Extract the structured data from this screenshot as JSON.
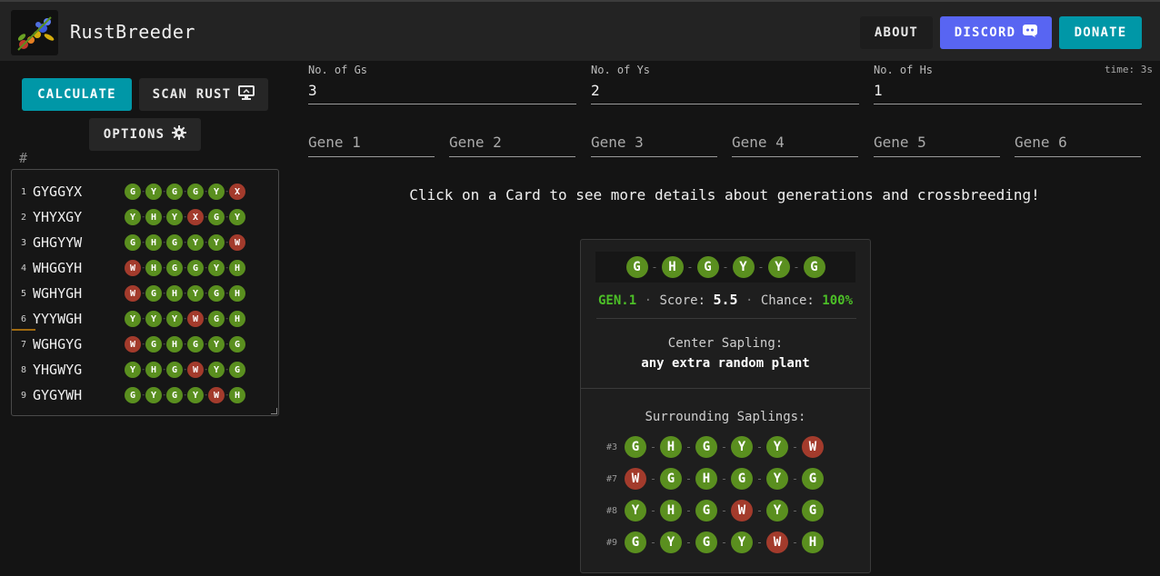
{
  "header": {
    "title": "RustBreeder",
    "about_label": "ABOUT",
    "discord_label": "DISCORD",
    "donate_label": "DONATE"
  },
  "toolbar": {
    "calculate_label": "CALCULATE",
    "scan_label": "SCAN RUST",
    "options_label": "OPTIONS"
  },
  "list": {
    "header": "#",
    "rows": [
      {
        "num": "1",
        "name": "GYGGYX",
        "genes": [
          "G",
          "Y",
          "G",
          "G",
          "Y",
          "X"
        ]
      },
      {
        "num": "2",
        "name": "YHYXGY",
        "genes": [
          "Y",
          "H",
          "Y",
          "X",
          "G",
          "Y"
        ]
      },
      {
        "num": "3",
        "name": "GHGYYW",
        "genes": [
          "G",
          "H",
          "G",
          "Y",
          "Y",
          "W"
        ]
      },
      {
        "num": "4",
        "name": "WHGGYH",
        "genes": [
          "W",
          "H",
          "G",
          "G",
          "Y",
          "H"
        ]
      },
      {
        "num": "5",
        "name": "WGHYGH",
        "genes": [
          "W",
          "G",
          "H",
          "Y",
          "G",
          "H"
        ]
      },
      {
        "num": "6",
        "name": "YYYWGH",
        "genes": [
          "Y",
          "Y",
          "Y",
          "W",
          "G",
          "H"
        ]
      },
      {
        "num": "7",
        "name": "WGHGYG",
        "genes": [
          "W",
          "G",
          "H",
          "G",
          "Y",
          "G"
        ]
      },
      {
        "num": "8",
        "name": "YHGWYG",
        "genes": [
          "Y",
          "H",
          "G",
          "W",
          "Y",
          "G"
        ]
      },
      {
        "num": "9",
        "name": "GYGYWH",
        "genes": [
          "G",
          "Y",
          "G",
          "Y",
          "W",
          "H"
        ]
      }
    ]
  },
  "counts": {
    "time": "time: 3s",
    "gs_label": "No. of Gs",
    "gs_value": "3",
    "ys_label": "No. of Ys",
    "ys_value": "2",
    "hs_label": "No. of Hs",
    "hs_value": "1"
  },
  "gene_inputs": [
    "Gene 1",
    "Gene 2",
    "Gene 3",
    "Gene 4",
    "Gene 5",
    "Gene 6"
  ],
  "hint": "Click on a Card to see more details about generations and crossbreeding!",
  "card": {
    "genes": [
      "G",
      "H",
      "G",
      "Y",
      "Y",
      "G"
    ],
    "gen": "GEN.1",
    "score_label": "Score:",
    "score": "5.5",
    "chance_label": "Chance:",
    "chance": "100%",
    "center_label": "Center Sapling:",
    "center_value": "any extra random plant",
    "surround_label": "Surrounding Saplings:",
    "saplings": [
      {
        "num": "#3",
        "genes": [
          "G",
          "H",
          "G",
          "Y",
          "Y",
          "W"
        ]
      },
      {
        "num": "#7",
        "genes": [
          "W",
          "G",
          "H",
          "G",
          "Y",
          "G"
        ]
      },
      {
        "num": "#8",
        "genes": [
          "Y",
          "H",
          "G",
          "W",
          "Y",
          "G"
        ]
      },
      {
        "num": "#9",
        "genes": [
          "G",
          "Y",
          "G",
          "Y",
          "W",
          "H"
        ]
      }
    ]
  },
  "colors": {
    "accent": "#0097a7",
    "discord": "#5865f2",
    "good_gene": "#5a8f1f",
    "bad_gene": "#a33b2c",
    "highlight_green": "#4cbf27"
  }
}
